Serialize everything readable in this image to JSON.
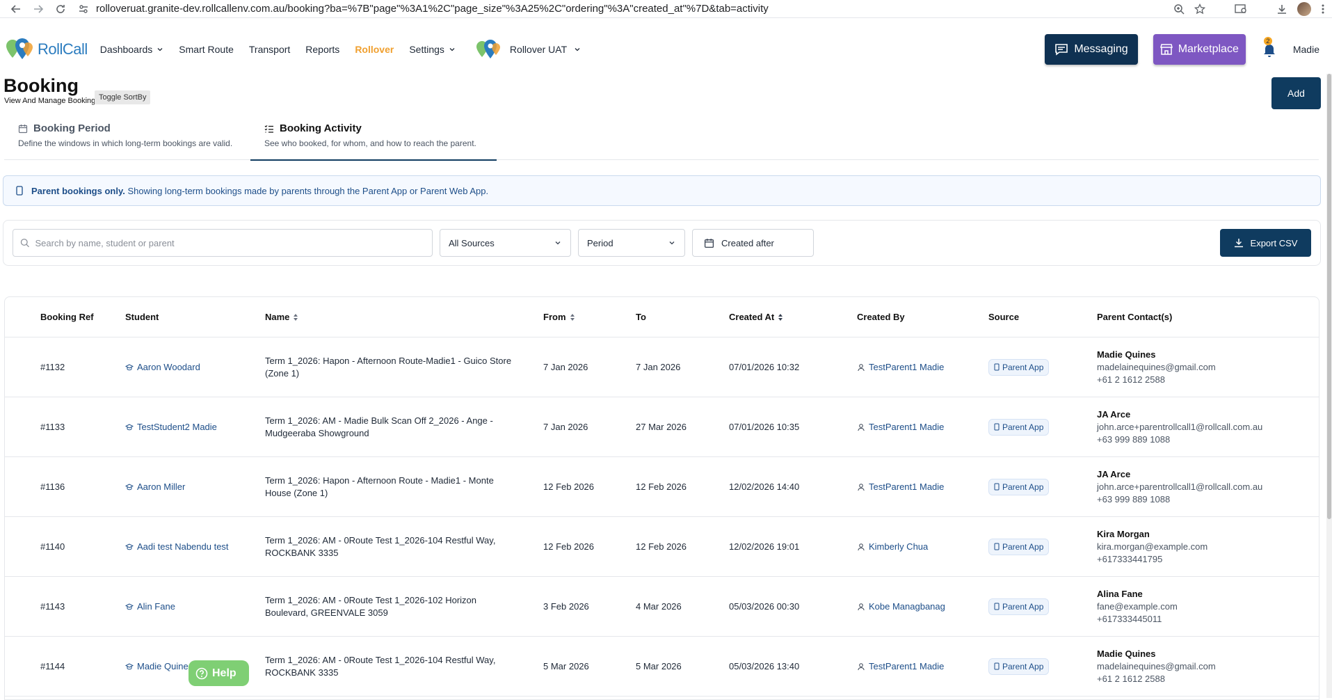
{
  "browser": {
    "url": "rolloveruat.granite-dev.rollcallenv.com.au/booking?ba=%7B\"page\"%3A1%2C\"page_size\"%3A25%2C\"ordering\"%3A\"created_at\"%7D&tab=activity"
  },
  "nav": {
    "logo_text": "RollCall",
    "items": [
      {
        "label": "Dashboards",
        "dropdown": true
      },
      {
        "label": "Smart Route",
        "dropdown": false
      },
      {
        "label": "Transport",
        "dropdown": false
      },
      {
        "label": "Reports",
        "dropdown": false
      },
      {
        "label": "Rollover",
        "dropdown": false,
        "active": true
      },
      {
        "label": "Settings",
        "dropdown": true
      }
    ],
    "org_name": "Rollover UAT",
    "messaging_label": "Messaging",
    "marketplace_label": "Marketplace",
    "notification_count": "2",
    "user_name": "Madie"
  },
  "page": {
    "title": "Booking",
    "subtitle": "View And Manage Booking",
    "tooltip": "Toggle SortBy",
    "add_label": "Add"
  },
  "tabs": [
    {
      "title": "Booking Period",
      "desc": "Define the windows in which long-term bookings are valid.",
      "icon": "calendar-icon"
    },
    {
      "title": "Booking Activity",
      "desc": "See who booked, for whom, and how to reach the parent.",
      "icon": "list-check-icon",
      "active": true
    }
  ],
  "banner": {
    "bold": "Parent bookings only.",
    "text": " Showing long-term bookings made by parents through the Parent App or Parent Web App."
  },
  "filters": {
    "search_placeholder": "Search by name, student or parent",
    "source_value": "All Sources",
    "period_value": "Period",
    "date_label": "Created after",
    "export_label": "Export CSV"
  },
  "table": {
    "headers": {
      "ref": "Booking Ref",
      "student": "Student",
      "name": "Name",
      "from": "From",
      "to": "To",
      "created": "Created At",
      "by": "Created By",
      "source": "Source",
      "parent": "Parent Contact(s)"
    },
    "rows": [
      {
        "ref": "#1132",
        "student": "Aaron Woodard",
        "name": "Term 1_2026: Hapon - Afternoon Route-Madie1 - Guico Store (Zone 1)",
        "from": "7 Jan 2026",
        "to": "7 Jan 2026",
        "created": "07/01/2026 10:32",
        "by": "TestParent1 Madie",
        "source": "Parent App",
        "p_name": "Madie Quines",
        "p_mail": "madelainequines@gmail.com",
        "p_phone": "+61 2 1612 2588"
      },
      {
        "ref": "#1133",
        "student": "TestStudent2 Madie",
        "name": "Term 1_2026: AM - Madie Bulk Scan Off 2_2026 - Ange - Mudgeeraba Showground",
        "from": "7 Jan 2026",
        "to": "27 Mar 2026",
        "created": "07/01/2026 10:35",
        "by": "TestParent1 Madie",
        "source": "Parent App",
        "p_name": "JA Arce",
        "p_mail": "john.arce+parentrollcall1@rollcall.com.au",
        "p_phone": "+63 999 889 1088"
      },
      {
        "ref": "#1136",
        "student": "Aaron Miller",
        "name": "Term 1_2026: Hapon - Afternoon Route - Madie1 - Monte House (Zone 1)",
        "from": "12 Feb 2026",
        "to": "12 Feb 2026",
        "created": "12/02/2026 14:40",
        "by": "TestParent1 Madie",
        "source": "Parent App",
        "p_name": "JA Arce",
        "p_mail": "john.arce+parentrollcall1@rollcall.com.au",
        "p_phone": "+63 999 889 1088"
      },
      {
        "ref": "#1140",
        "student": "Aadi test Nabendu test",
        "name": "Term 1_2026: AM - 0Route Test 1_2026-104 Restful Way, ROCKBANK 3335",
        "from": "12 Feb 2026",
        "to": "12 Feb 2026",
        "created": "12/02/2026 19:01",
        "by": "Kimberly Chua",
        "source": "Parent App",
        "p_name": "Kira Morgan",
        "p_mail": "kira.morgan@example.com",
        "p_phone": "+617333441795"
      },
      {
        "ref": "#1143",
        "student": "Alin Fane",
        "name": "Term 1_2026: AM - 0Route Test 1_2026-102 Horizon Boulevard, GREENVALE 3059",
        "from": "3 Feb 2026",
        "to": "4 Mar 2026",
        "created": "05/03/2026 00:30",
        "by": "Kobe Managbanag",
        "source": "Parent App",
        "p_name": "Alina Fane",
        "p_mail": "fane@example.com",
        "p_phone": "+617333445011"
      },
      {
        "ref": "#1144",
        "student": "Madie Quines",
        "name": "Term 1_2026: AM - 0Route Test 1_2026-104 Restful Way, ROCKBANK 3335",
        "from": "5 Mar 2026",
        "to": "5 Mar 2026",
        "created": "05/03/2026 13:40",
        "by": "TestParent1 Madie",
        "source": "Parent App",
        "p_name": "Madie Quines",
        "p_mail": "madelainequines@gmail.com",
        "p_phone": "+61 2 1612 2588"
      }
    ]
  },
  "help_label": "Help",
  "colors": {
    "brand_dark": "#0f3b5f",
    "messaging": "#0f3152",
    "marketplace": "#7e57c2",
    "active_nav": "#f0a030",
    "help": "#7fcf74",
    "link": "#1d4e89"
  }
}
